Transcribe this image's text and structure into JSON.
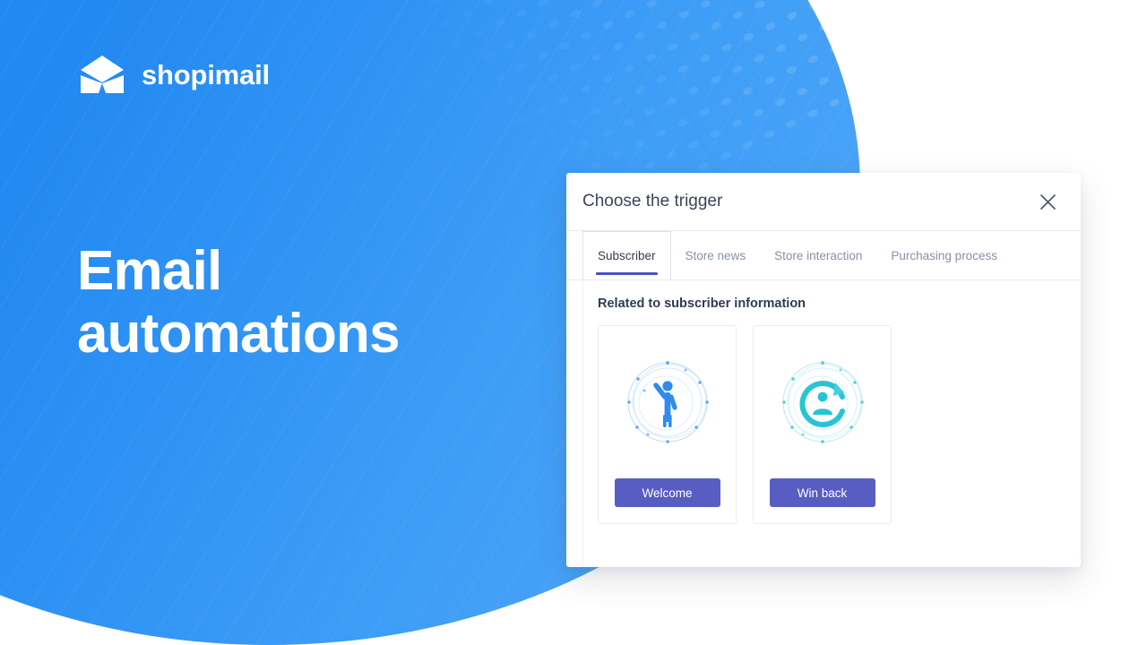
{
  "brand": {
    "name": "shopimail",
    "logo_icon": "open-envelope-icon",
    "logo_color": "#ffffff",
    "background_color": "#2289f2"
  },
  "hero": {
    "headline": "Email\nautomations"
  },
  "modal": {
    "title": "Choose the trigger",
    "close_icon": "close-icon",
    "tabs": [
      {
        "label": "Subscriber",
        "active": true
      },
      {
        "label": "Store news",
        "active": false
      },
      {
        "label": "Store interaction",
        "active": false
      },
      {
        "label": "Purchasing process",
        "active": false
      }
    ],
    "active_tab_underline_color": "#4c51c6",
    "section_title": "Related to subscriber information",
    "cards": [
      {
        "icon": "person-waving-icon",
        "icon_color": "#3b95f0",
        "button_label": "Welcome"
      },
      {
        "icon": "person-refresh-icon",
        "icon_color": "#2ec5d3",
        "button_label": "Win back"
      }
    ],
    "button_color": "#585dc4"
  }
}
